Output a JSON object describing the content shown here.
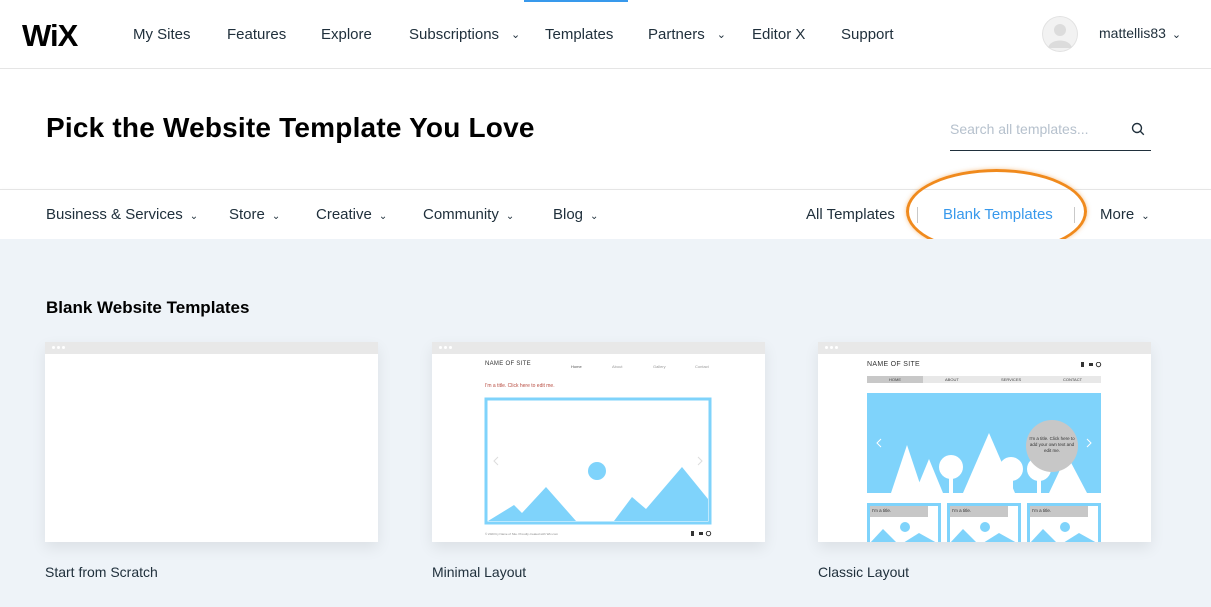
{
  "nav": {
    "items": [
      {
        "label": "My Sites"
      },
      {
        "label": "Features"
      },
      {
        "label": "Explore"
      },
      {
        "label": "Subscriptions",
        "chevron": true
      },
      {
        "label": "Templates",
        "active": true
      },
      {
        "label": "Partners",
        "chevron": true
      },
      {
        "label": "Editor X"
      },
      {
        "label": "Support"
      }
    ],
    "username": "mattellis83"
  },
  "header": {
    "title": "Pick the Website Template You Love",
    "search_placeholder": "Search all templates..."
  },
  "categories": {
    "left": [
      {
        "label": "Business & Services"
      },
      {
        "label": "Store"
      },
      {
        "label": "Creative"
      },
      {
        "label": "Community"
      },
      {
        "label": "Blog"
      }
    ],
    "all_templates": "All Templates",
    "blank_templates": "Blank Templates",
    "more": "More"
  },
  "section": {
    "title": "Blank Website Templates"
  },
  "cards": [
    {
      "label": "Start from Scratch"
    },
    {
      "label": "Minimal Layout",
      "preview": {
        "site_name": "NAME OF SITE",
        "menu": [
          "Home",
          "About",
          "Gallery",
          "Contact"
        ],
        "title_text": "I'm a title. Click here to edit me.",
        "footer_text": "© 2023 by Name of Site. Proudly created with Wix.com"
      }
    },
    {
      "label": "Classic Layout",
      "preview": {
        "site_name": "NAME OF SITE",
        "menu": [
          "HOME",
          "ABOUT",
          "SERVICES",
          "CONTACT"
        ],
        "bubble_text": "I'm a title. Click here to add your own text and edit me.",
        "box_titles": [
          "I'm a title.",
          "I'm a title.",
          "I'm a title."
        ]
      }
    }
  ],
  "colors": {
    "accent": "#3899ec",
    "highlight": "#f08a1d",
    "content_bg": "#eef3f8",
    "preview_blue": "#7fd3fb"
  }
}
